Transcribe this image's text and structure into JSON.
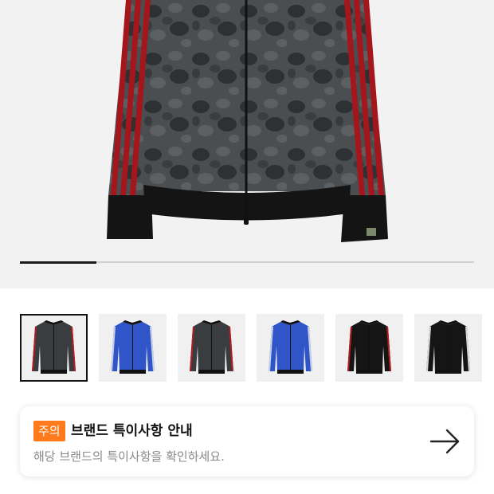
{
  "gallery": {
    "carousel_progress": 0.168,
    "thumbnails": [
      {
        "name": "thumb-gray-camo-jacket",
        "color": "#3a3d3f",
        "stripe": "#b01c20",
        "selected": true
      },
      {
        "name": "thumb-blue-camo-jacket",
        "color": "#2f55c8",
        "stripe": "#c8d0e8",
        "selected": false
      },
      {
        "name": "thumb-gray-camo-jacket-alt",
        "color": "#3a3d3f",
        "stripe": "#b01c20",
        "selected": false
      },
      {
        "name": "thumb-blue-camo-jacket-alt",
        "color": "#2f55c8",
        "stripe": "#c8d0e8",
        "selected": false
      },
      {
        "name": "thumb-black-red-jacket",
        "color": "#151515",
        "stripe": "#b01c20",
        "selected": false
      },
      {
        "name": "thumb-black-white-jacket",
        "color": "#151515",
        "stripe": "#d9d9d9",
        "selected": false
      }
    ]
  },
  "notice": {
    "badge": "주의",
    "title": "브랜드 특이사항 안내",
    "description": "해당 브랜드의 특이사항을 확인하세요.",
    "badge_color": "#ff7a1a"
  }
}
